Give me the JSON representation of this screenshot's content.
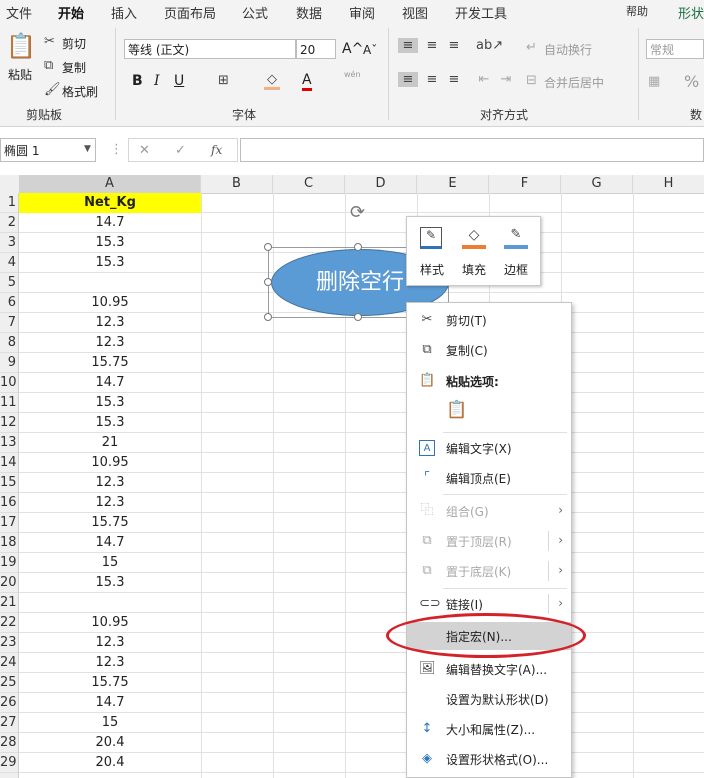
{
  "ribbon": {
    "tabs": [
      "文件",
      "开始",
      "插入",
      "页面布局",
      "公式",
      "数据",
      "审阅",
      "视图",
      "开发工具",
      "帮助",
      "形状"
    ],
    "active_tab": "开始",
    "clipboard": {
      "paste": "粘贴",
      "cut": "剪切",
      "copy": "复制",
      "format_painter": "格式刷",
      "group_label": "剪贴板"
    },
    "font": {
      "name": "等线 (正文)",
      "size": "20",
      "bold": "B",
      "italic": "I",
      "underline": "U",
      "group_label": "字体",
      "font_color_glyph": "A",
      "phonetic": "wén"
    },
    "alignment": {
      "wrap_text": "自动换行",
      "merge_center": "合并后居中",
      "group_label": "对齐方式"
    },
    "number": {
      "format": "常规",
      "percent": "%",
      "group_label": "数"
    }
  },
  "formula_bar": {
    "name_box": "椭圆 1",
    "cancel": "✕",
    "enter": "✓",
    "fx": "fx",
    "value": ""
  },
  "columns": [
    "A",
    "B",
    "C",
    "D",
    "E",
    "F",
    "G",
    "H"
  ],
  "rows": [
    {
      "n": "1",
      "a": "Net_Kg"
    },
    {
      "n": "2",
      "a": "14.7"
    },
    {
      "n": "3",
      "a": "15.3"
    },
    {
      "n": "4",
      "a": "15.3"
    },
    {
      "n": "5",
      "a": ""
    },
    {
      "n": "6",
      "a": "10.95"
    },
    {
      "n": "7",
      "a": "12.3"
    },
    {
      "n": "8",
      "a": "12.3"
    },
    {
      "n": "9",
      "a": "15.75"
    },
    {
      "n": "10",
      "a": "14.7"
    },
    {
      "n": "11",
      "a": "15.3"
    },
    {
      "n": "12",
      "a": "15.3"
    },
    {
      "n": "13",
      "a": "21"
    },
    {
      "n": "14",
      "a": "10.95"
    },
    {
      "n": "15",
      "a": "12.3"
    },
    {
      "n": "16",
      "a": "12.3"
    },
    {
      "n": "17",
      "a": "15.75"
    },
    {
      "n": "18",
      "a": "14.7"
    },
    {
      "n": "19",
      "a": "15"
    },
    {
      "n": "20",
      "a": "15.3"
    },
    {
      "n": "21",
      "a": ""
    },
    {
      "n": "22",
      "a": "10.95"
    },
    {
      "n": "23",
      "a": "12.3"
    },
    {
      "n": "24",
      "a": "12.3"
    },
    {
      "n": "25",
      "a": "15.75"
    },
    {
      "n": "26",
      "a": "14.7"
    },
    {
      "n": "27",
      "a": "15"
    },
    {
      "n": "28",
      "a": "20.4"
    },
    {
      "n": "29",
      "a": "20.4"
    }
  ],
  "header_cell_color": "#ffff00",
  "shape": {
    "text": "删除空行",
    "fill": "#5b9bd5"
  },
  "mini_toolbar": {
    "style": "样式",
    "fill": "填充",
    "outline": "边框"
  },
  "context_menu": [
    {
      "label": "剪切(T)",
      "icon": "scissors-icon",
      "disabled": false
    },
    {
      "label": "复制(C)",
      "icon": "copy-icon",
      "disabled": false
    },
    {
      "label": "粘贴选项:",
      "icon": "paste-icon",
      "disabled": false
    },
    {
      "label": "编辑文字(X)",
      "icon": "edit-text-icon",
      "disabled": false
    },
    {
      "label": "编辑顶点(E)",
      "icon": "edit-points-icon",
      "disabled": false
    },
    {
      "label": "组合(G)",
      "icon": "group-icon",
      "disabled": true
    },
    {
      "label": "置于顶层(R)",
      "icon": "bring-front-icon",
      "disabled": true
    },
    {
      "label": "置于底层(K)",
      "icon": "send-back-icon",
      "disabled": true
    },
    {
      "label": "链接(I)",
      "icon": "link-icon",
      "disabled": false
    },
    {
      "label": "指定宏(N)...",
      "icon": "",
      "disabled": false
    },
    {
      "label": "编辑替换文字(A)...",
      "icon": "alt-text-icon",
      "disabled": false
    },
    {
      "label": "设置为默认形状(D)",
      "icon": "",
      "disabled": false
    },
    {
      "label": "大小和属性(Z)...",
      "icon": "size-icon",
      "disabled": false
    },
    {
      "label": "设置形状格式(O)...",
      "icon": "format-shape-icon",
      "disabled": false
    }
  ],
  "highlight_color": "#d3222a"
}
